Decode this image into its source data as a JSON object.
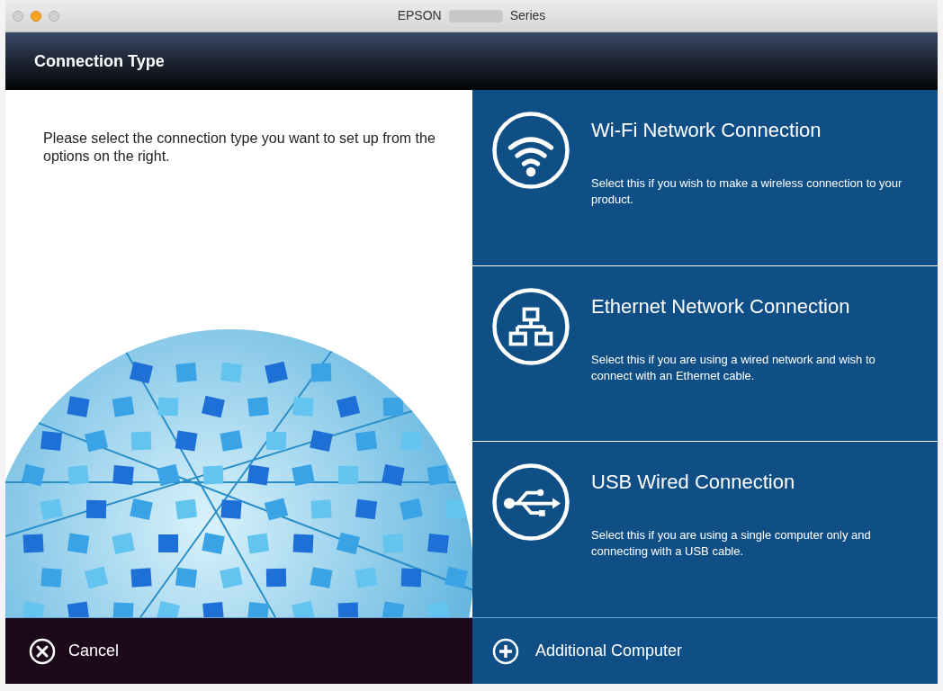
{
  "window": {
    "title_parts": [
      "EPSON",
      "Series"
    ]
  },
  "header": {
    "title": "Connection Type"
  },
  "instructions": "Please select the connection type you want to set up from the options on the right.",
  "options": [
    {
      "kind": "wifi",
      "title": "Wi-Fi Network Connection",
      "description": "Select this if you wish to make a wireless connection to your product."
    },
    {
      "kind": "ethernet",
      "title": "Ethernet Network Connection",
      "description": "Select this if you are using a wired network and wish to connect with an Ethernet cable."
    },
    {
      "kind": "usb",
      "title": "USB Wired Connection",
      "description": "Select this if you are using a single computer only and connecting with a USB cable."
    }
  ],
  "footer": {
    "cancel": "Cancel",
    "additional": "Additional Computer"
  }
}
